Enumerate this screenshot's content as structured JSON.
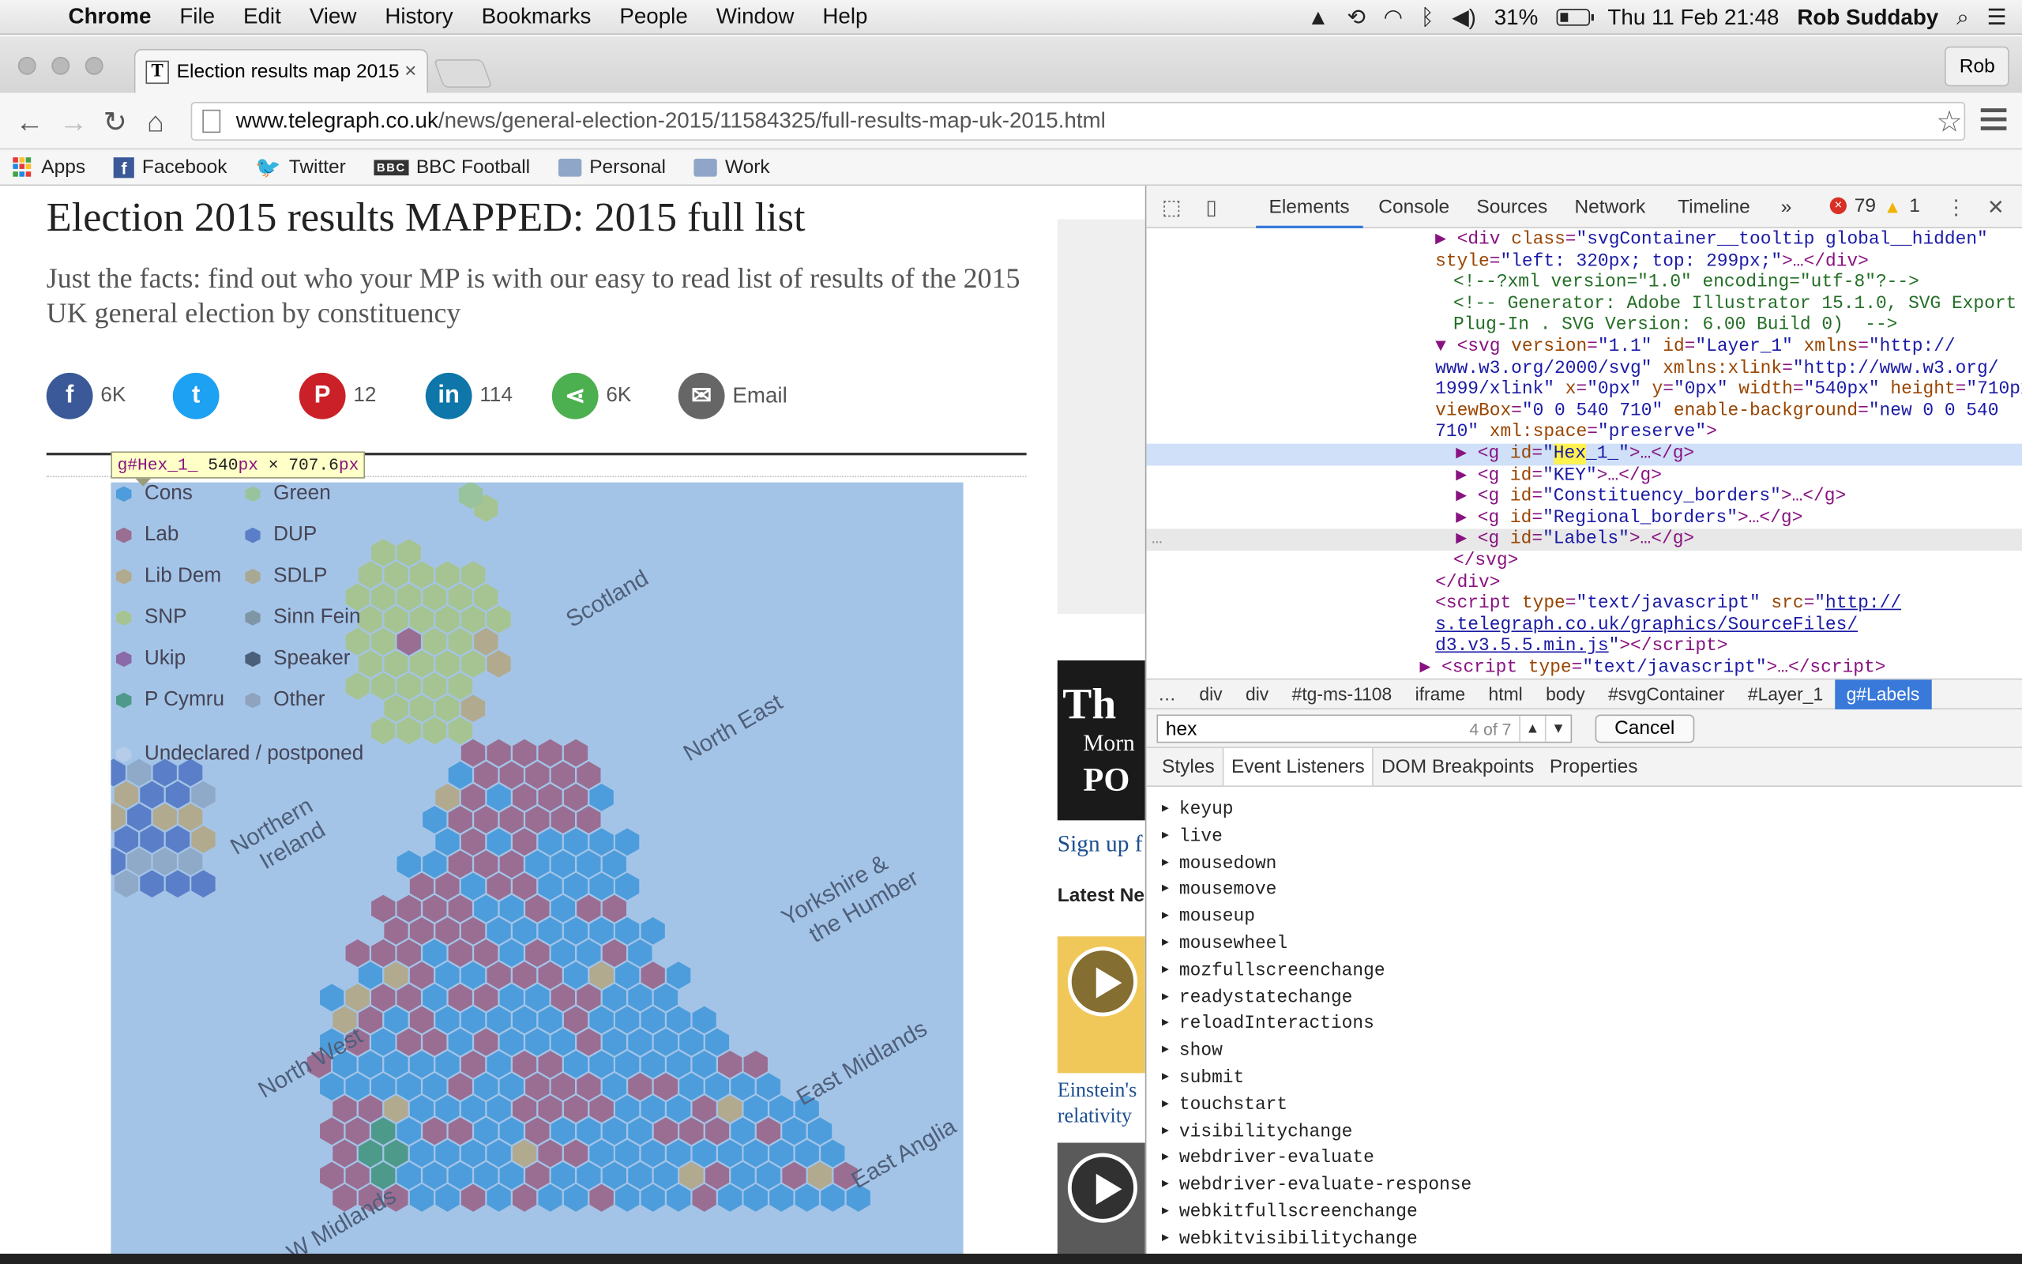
{
  "menubar": {
    "app": "Chrome",
    "items": [
      "File",
      "Edit",
      "View",
      "History",
      "Bookmarks",
      "People",
      "Window",
      "Help"
    ],
    "battery": "31%",
    "datetime": "Thu 11 Feb  21:48",
    "user": "Rob Suddaby"
  },
  "browser": {
    "tab_title": "Election results map 2015:",
    "profile": "Rob",
    "url_host": "www.telegraph.co.uk",
    "url_path": "/news/general-election-2015/11584325/full-results-map-uk-2015.html",
    "bookmarks": [
      "Apps",
      "Facebook",
      "Twitter",
      "BBC Football",
      "Personal",
      "Work"
    ]
  },
  "article": {
    "headline": "Election 2015 results MAPPED: 2015 full list",
    "subhead": "Just the facts: find out who your MP is with our easy to read list of results of the 2015 UK general election by constituency",
    "shares": {
      "facebook": "6K",
      "pinterest": "12",
      "linkedin": "114",
      "share": "6K",
      "email": "Email"
    }
  },
  "tooltip": {
    "selector": "g#Hex_1_",
    "width": "540",
    "height": "707.6",
    "unit": "px",
    "times": "×"
  },
  "map": {
    "legend": [
      {
        "label": "Cons",
        "color": "#4d9ddc"
      },
      {
        "label": "Lab",
        "color": "#9a6e93"
      },
      {
        "label": "Lib Dem",
        "color": "#b2aa8e"
      },
      {
        "label": "SNP",
        "color": "#a6c492"
      },
      {
        "label": "Ukip",
        "color": "#8b6aa8"
      },
      {
        "label": "P Cymru",
        "color": "#4e9a8a"
      },
      {
        "label": "Green",
        "color": "#99c39d"
      },
      {
        "label": "DUP",
        "color": "#5a7fc8"
      },
      {
        "label": "SDLP",
        "color": "#a8a893"
      },
      {
        "label": "Sinn Fein",
        "color": "#7f96a7"
      },
      {
        "label": "Speaker",
        "color": "#4a5f7a"
      },
      {
        "label": "Other",
        "color": "#8fa3bf"
      }
    ],
    "undeclared": "Undeclared / postponed",
    "regions": {
      "scotland": "Scotland",
      "northern_ireland": [
        "Northern",
        "Ireland"
      ],
      "north_east": "North East",
      "yorkshire": [
        "Yorkshire &",
        "the Humber"
      ],
      "north_west": "North West",
      "east_midlands": "East Midlands",
      "east_anglia": "East Anglia",
      "w_midlands": "W Midlands"
    }
  },
  "sidebar": {
    "thumb_text": [
      "Th",
      "Morn",
      "PO"
    ],
    "signup": "Sign up f",
    "latest": "Latest Ne",
    "einstein": [
      "Einstein's",
      "relativity"
    ]
  },
  "devtools": {
    "tabs": [
      "Elements",
      "Console",
      "Sources",
      "Network",
      "Timeline"
    ],
    "errors": "79",
    "warnings": "1",
    "crumbs": [
      "…",
      "div",
      "div",
      "#tg-ms-1108",
      "iframe",
      "html",
      "body",
      "#svgContainer",
      "#Layer_1",
      "g#Labels"
    ],
    "search_query": "hex",
    "search_count": "4 of 7",
    "cancel": "Cancel",
    "subtabs": [
      "Styles",
      "Event Listeners",
      "DOM Breakpoints",
      "Properties"
    ],
    "events": [
      "keyup",
      "live",
      "mousedown",
      "mousemove",
      "mouseup",
      "mousewheel",
      "mozfullscreenchange",
      "readystatechange",
      "reloadInteractions",
      "show",
      "submit",
      "touchstart",
      "visibilitychange",
      "webdriver-evaluate",
      "webdriver-evaluate-response",
      "webkitfullscreenchange",
      "webkitvisibilitychange"
    ],
    "dom": {
      "div_class": "svgContainer__tooltip global__hidden",
      "div_style": "left: 320px; top: 299px;",
      "xml_comment": "<!--?xml version=\"1.0\" encoding=\"utf-8\"?-->",
      "gen_comment_1": "<!-- Generator: Adobe Illustrator 15.1.0, SVG Export",
      "gen_comment_2": "Plug-In . SVG Version: 6.00 Build 0)  -->",
      "svg_line_1": "\"1.1\"",
      "svg_id": "\"Layer_1\"",
      "svg_xmlns": "\"http://",
      "svg_line_2a": "www.w3.org/2000/svg\"",
      "svg_xlink": "\"http://www.w3.org/",
      "svg_line_3a": "1999/xlink\"",
      "svg_x": "\"0px\"",
      "svg_y": "\"0px\"",
      "svg_w": "\"540px\"",
      "svg_h": "\"710px\"",
      "svg_vb": "\"0 0 540 710\"",
      "svg_eb": "\"new 0 0 540",
      "svg_eb2": "710\"",
      "svg_space": "\"preserve\"",
      "g_hex_pre": "\"",
      "g_hex_match": "Hex",
      "g_hex_post": "_1_\"",
      "g_ids": [
        "\"KEY\"",
        "\"Constituency_borders\"",
        "\"Regional_borders\"",
        "\"Labels\""
      ],
      "script_src_1": "http://",
      "script_src_2": "s.telegraph.co.uk/graphics/SourceFiles/",
      "script_src_3": "d3.v3.5.5.min.js"
    }
  }
}
